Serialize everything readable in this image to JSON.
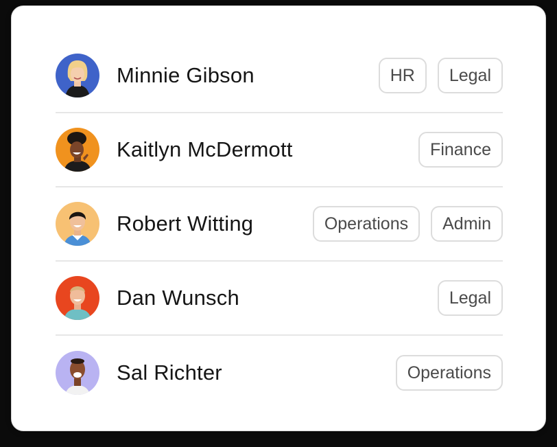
{
  "people": [
    {
      "name": "Minnie Gibson",
      "tags": [
        "HR",
        "Legal"
      ],
      "avatar_bg": "#3f63c9"
    },
    {
      "name": "Kaitlyn McDermott",
      "tags": [
        "Finance"
      ],
      "avatar_bg": "#f0921e"
    },
    {
      "name": "Robert Witting",
      "tags": [
        "Operations",
        "Admin"
      ],
      "avatar_bg": "#f7c173"
    },
    {
      "name": "Dan Wunsch",
      "tags": [
        "Legal"
      ],
      "avatar_bg": "#e8461f"
    },
    {
      "name": "Sal Richter",
      "tags": [
        "Operations"
      ],
      "avatar_bg": "#b9b3f2"
    }
  ]
}
